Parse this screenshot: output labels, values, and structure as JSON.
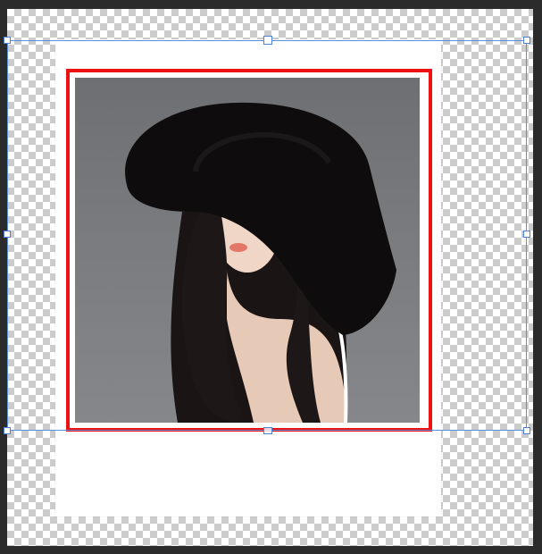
{
  "document": {
    "colors": {
      "workspace": "#2b2b2b",
      "frame_border": "#ee1111",
      "frame_fill": "#ffffff",
      "selection": "#4f7fd6"
    }
  },
  "image_layer": {
    "subject_icon": "portrait-photo"
  },
  "transform_handles": [
    "top-left",
    "top-center",
    "top-right",
    "middle-left",
    "middle-right",
    "bottom-left",
    "bottom-center",
    "bottom-right"
  ]
}
